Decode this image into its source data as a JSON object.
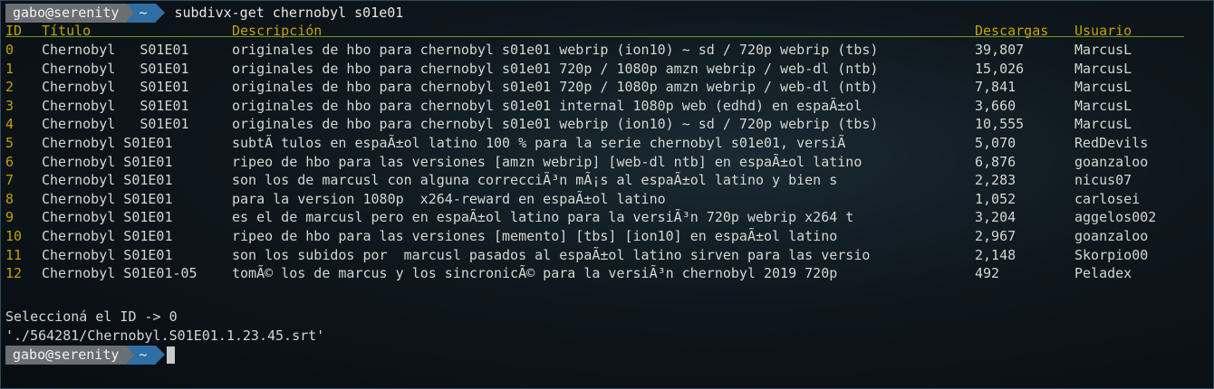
{
  "prompt": {
    "user": "gabo@serenity",
    "dir": "~",
    "command": "subdivx-get chernobyl s01e01"
  },
  "headers": {
    "id": "ID",
    "title": "Título",
    "desc": "Descripción",
    "downloads": "Descargas",
    "user": "Usuario"
  },
  "rows": [
    {
      "id": "0",
      "title": "Chernobyl   S01E01",
      "desc": "originales de hbo para chernobyl s01e01 webrip (ion10) ~ sd / 720p webrip (tbs)",
      "downloads": "39,807",
      "user": "MarcusL"
    },
    {
      "id": "1",
      "title": "Chernobyl   S01E01",
      "desc": "originales de hbo para chernobyl s01e01 720p / 1080p amzn webrip / web-dl (ntb)",
      "downloads": "15,026",
      "user": "MarcusL"
    },
    {
      "id": "2",
      "title": "Chernobyl   S01E01",
      "desc": "originales de hbo para chernobyl s01e01 720p / 1080p amzn webrip / web-dl (ntb)",
      "downloads": "7,841",
      "user": "MarcusL"
    },
    {
      "id": "3",
      "title": "Chernobyl   S01E01",
      "desc": "originales de hbo para chernobyl s01e01 internal 1080p web (edhd) en espaÃ±ol",
      "downloads": "3,660",
      "user": "MarcusL"
    },
    {
      "id": "4",
      "title": "Chernobyl   S01E01",
      "desc": "originales de hbo para chernobyl s01e01 webrip (ion10) ~ sd / 720p webrip (tbs)",
      "downloads": "10,555",
      "user": "MarcusL"
    },
    {
      "id": "5",
      "title": "Chernobyl S01E01",
      "desc": "subtÃ tulos en espaÃ±ol latino 100 % para la serie chernobyl s01e01, versiÃ",
      "downloads": "5,070",
      "user": "RedDevils"
    },
    {
      "id": "6",
      "title": "Chernobyl S01E01",
      "desc": "ripeo de hbo para las versiones [amzn webrip] [web-dl ntb] en espaÃ±ol latino",
      "downloads": "6,876",
      "user": "goanzaloo"
    },
    {
      "id": "7",
      "title": "Chernobyl S01E01",
      "desc": "son los de marcusl con alguna correcciÃ³n mÃ¡s al espaÃ±ol latino y bien s",
      "downloads": "2,283",
      "user": "nicus07"
    },
    {
      "id": "8",
      "title": "Chernobyl S01E01",
      "desc": "para la version 1080p  x264-reward en espaÃ±ol latino",
      "downloads": "1,052",
      "user": "carlosei"
    },
    {
      "id": "9",
      "title": "Chernobyl S01E01",
      "desc": "es el de marcusl pero en espaÃ±ol latino para la versiÃ³n 720p webrip x264 t",
      "downloads": "3,204",
      "user": "aggelos002"
    },
    {
      "id": "10",
      "title": "Chernobyl S01E01",
      "desc": "ripeo de hbo para las versiones [memento] [tbs] [ion10] en espaÃ±ol latino",
      "downloads": "2,967",
      "user": "goanzaloo"
    },
    {
      "id": "11",
      "title": "Chernobyl S01E01",
      "desc": "son los subidos por  marcusl pasados al espaÃ±ol latino sirven para las versio",
      "downloads": "2,148",
      "user": "Skorpio00"
    },
    {
      "id": "12",
      "title": "Chernobyl S01E01-05",
      "desc": "tomÃ© los de marcus y los sincronicÃ© para la versiÃ³n chernobyl 2019 720p",
      "downloads": "492",
      "user": "Peladex"
    }
  ],
  "selection_line": "Seleccioná el ID -> 0",
  "result_line": "'./564281/Chernobyl.S01E01.1.23.45.srt'",
  "prompt2": {
    "user": "gabo@serenity",
    "dir": "~"
  }
}
